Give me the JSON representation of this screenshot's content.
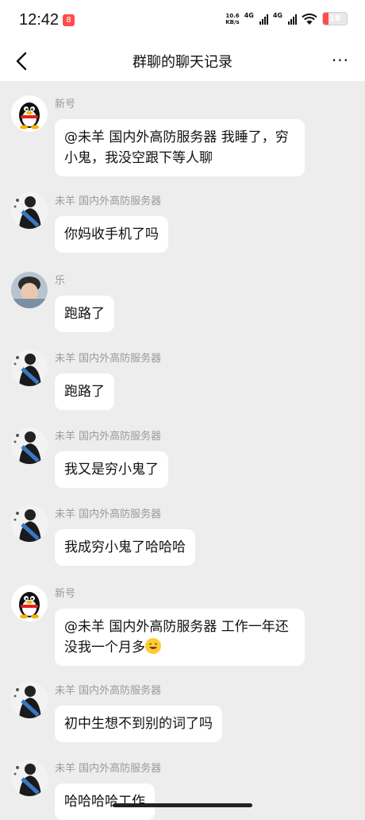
{
  "status_bar": {
    "time": "12:42",
    "notification_badge": "8",
    "net_speed_value": "10.6",
    "net_speed_unit": "KB/s",
    "signal_tag_1": "4G",
    "signal_tag_2": "4G",
    "battery_level": "18",
    "battery_color": "#ff4d4f"
  },
  "nav": {
    "title": "群聊的聊天记录",
    "more_label": "···"
  },
  "messages": [
    {
      "sender": "新号",
      "text": "@未羊 国内外高防服务器 我睡了，穷小鬼，我没空跟下等人聊",
      "avatar_icon": "qq-penguin-icon"
    },
    {
      "sender": "未羊 国内外高防服务器",
      "text": "你妈收手机了吗",
      "avatar_icon": "user-photo-icon"
    },
    {
      "sender": "乐",
      "text": "跑路了",
      "avatar_icon": "user-photo-icon"
    },
    {
      "sender": "未羊 国内外高防服务器",
      "text": "跑路了",
      "avatar_icon": "user-photo-icon"
    },
    {
      "sender": "未羊 国内外高防服务器",
      "text": "我又是穷小鬼了",
      "avatar_icon": "user-photo-icon"
    },
    {
      "sender": "未羊 国内外高防服务器",
      "text": "我成穷小鬼了哈哈哈",
      "avatar_icon": "user-photo-icon"
    },
    {
      "sender": "新号",
      "text": "@未羊 国内外高防服务器 工作一年还没我一个月多",
      "emoji": "laughing-emoji-icon",
      "avatar_icon": "qq-penguin-icon"
    },
    {
      "sender": "未羊 国内外高防服务器",
      "text": "初中生想不到别的词了吗",
      "avatar_icon": "user-photo-icon"
    },
    {
      "sender": "未羊 国内外高防服务器",
      "text": "哈哈哈哈工作",
      "avatar_icon": "user-photo-icon"
    }
  ],
  "colors": {
    "background": "#ededed",
    "bubble": "#ffffff",
    "sender_text": "#9a9a9a"
  }
}
